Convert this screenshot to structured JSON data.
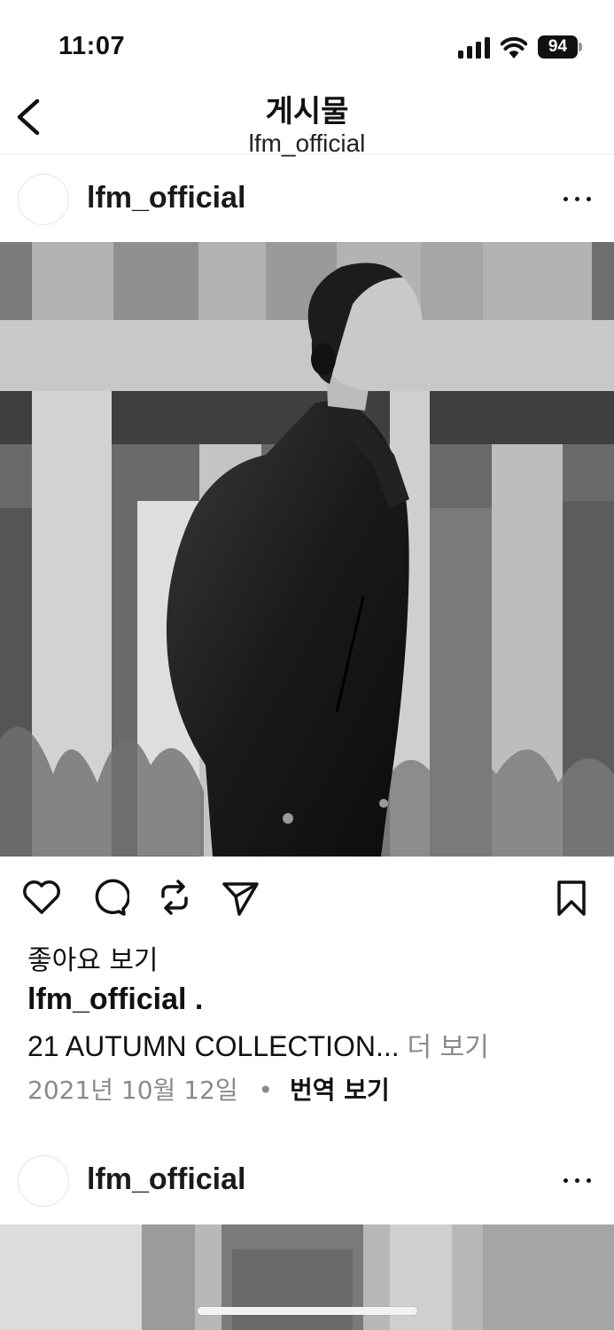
{
  "status_bar": {
    "time": "11:07",
    "battery": "94"
  },
  "header": {
    "title": "게시물",
    "subtitle": "lfm_official"
  },
  "posts": [
    {
      "username": "lfm_official",
      "likes_label": "좋아요 보기",
      "caption_user": "lfm_official .",
      "caption_text": "21 AUTUMN COLLECTION...",
      "more_label": "더 보기",
      "date": "2021년 10월 12일",
      "separator": "•",
      "translate_label": "번역 보기"
    },
    {
      "username": "lfm_official"
    }
  ],
  "colors": {
    "secondary_text": "#8a8a8a",
    "text": "#111111",
    "divider": "#efefef"
  }
}
